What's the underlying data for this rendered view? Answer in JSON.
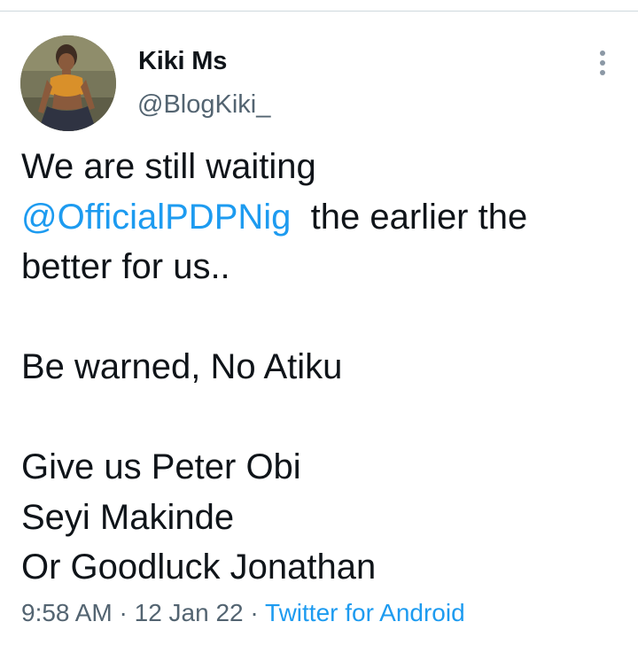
{
  "author": {
    "display_name": "Kiki Ms",
    "handle": "@BlogKiki_"
  },
  "tweet": {
    "line1": "We are still waiting",
    "mention": "@OfficialPDPNig",
    "line2_rest": "  the earlier the",
    "line3": "better for us..",
    "line4": "Be warned, No Atiku",
    "line5": "Give us Peter Obi",
    "line6": "Seyi Makinde",
    "line7": "Or Goodluck Jonathan"
  },
  "meta": {
    "time": "9:58 AM",
    "separator1": " · ",
    "date": "12 Jan 22",
    "separator2": " · ",
    "source": "Twitter for Android"
  },
  "icons": {
    "more": "more-vertical-icon"
  },
  "colors": {
    "link": "#1d9bf0",
    "secondary_text": "#536471",
    "primary_text": "#0f1419"
  }
}
